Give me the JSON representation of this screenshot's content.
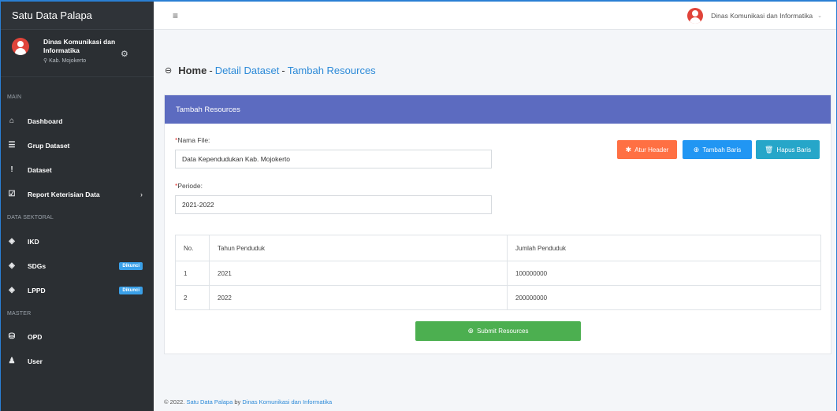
{
  "app": {
    "title": "Satu Data Palapa"
  },
  "user": {
    "name": "Dinas Komunikasi dan Informatika",
    "location": "Kab. Mojokerto"
  },
  "sidebar": {
    "sections": [
      "MAIN",
      "DATA SEKTORAL",
      "MASTER"
    ],
    "main_items": [
      {
        "label": "Dashboard",
        "icon": "home-icon"
      },
      {
        "label": "Grup Dataset",
        "icon": "list-icon"
      },
      {
        "label": "Dataset",
        "icon": "exclamation-icon"
      },
      {
        "label": "Report Keterisian Data",
        "icon": "clipboard-check-icon"
      }
    ],
    "sektoral_items": [
      {
        "label": "IKD",
        "icon": "layers-icon"
      },
      {
        "label": "SDGs",
        "icon": "layers-icon",
        "badge": "Dikunci"
      },
      {
        "label": "LPPD",
        "icon": "layers-icon",
        "badge": "Dikunci"
      }
    ],
    "master_items": [
      {
        "label": "OPD",
        "icon": "database-icon"
      },
      {
        "label": "User",
        "icon": "user-icon"
      }
    ]
  },
  "topbar": {
    "user_name": "Dinas Komunikasi dan Informatika"
  },
  "breadcrumb": {
    "home": "Home",
    "sep": "-",
    "detail": "Detail Dataset",
    "current": "Tambah Resources"
  },
  "card": {
    "title": "Tambah Resources"
  },
  "form": {
    "nama_file_label": "Nama File:",
    "nama_file_value": "Data Kependudukan Kab. Mojokerto",
    "periode_label": "Periode:",
    "periode_value": "2021-2022",
    "required_mark": "*"
  },
  "buttons": {
    "atur_header": "Atur Header",
    "tambah_baris": "Tambah Baris",
    "hapus_baris": "Hapus Baris",
    "submit": "Submit Resources"
  },
  "table": {
    "headers": [
      "No.",
      "Tahun Penduduk",
      "Jumlah Penduduk"
    ],
    "rows": [
      [
        "1",
        "2021",
        "100000000"
      ],
      [
        "2",
        "2022",
        "200000000"
      ]
    ]
  },
  "footer": {
    "prefix": "© 2022.",
    "app_link": "Satu Data Palapa",
    "by": "by",
    "org_link": "Dinas Komunikasi dan Informatika"
  },
  "colors": {
    "sidebar": "#2b2f33",
    "card_header": "#5c6bc0",
    "orange": "#ff7043",
    "blue": "#2196f3",
    "teal": "#26a6c9",
    "green": "#4caf50"
  }
}
